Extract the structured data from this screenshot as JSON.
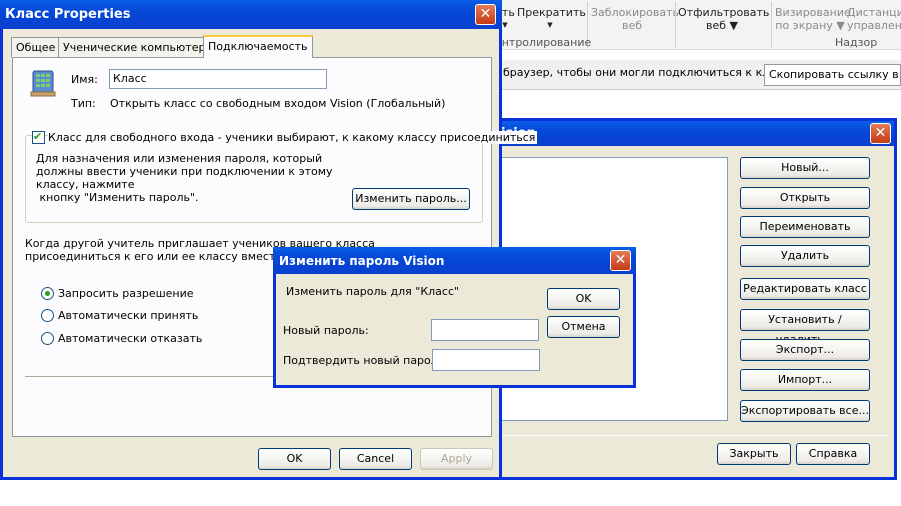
{
  "ribbon": {
    "items": [
      {
        "label": "ать",
        "arrow": "▼"
      },
      {
        "label": "Прекратить",
        "arrow": "▼"
      },
      {
        "label_line1": "Заблокировать",
        "label_line2": "веб"
      },
      {
        "label_line1": "Отфильтровать",
        "label_line2": "веб ▼"
      },
      {
        "label_line1": "Визирование",
        "label_line2": "по экрану ▼"
      },
      {
        "label_line1": "Дистанци",
        "label_line2": "управлен"
      }
    ],
    "group_control": "онтролирование",
    "group_supervision": "Надзор"
  },
  "address_bar": {
    "text": "браузер, чтобы они могли подключиться к классу.",
    "copy_link": "Скопировать ссылку в бу"
  },
  "vision_window": {
    "title": "ision",
    "buttons": [
      "Новый...",
      "Открыть",
      "Переименовать",
      "Удалить",
      "Редактировать класс",
      "Установить / удалить...",
      "Экспорт...",
      "Импорт...",
      "Экспортировать все..."
    ],
    "close": "Закрыть",
    "help": "Справка"
  },
  "props_window": {
    "title": "Класс Properties",
    "tabs": [
      "Общее",
      "Ученические компьютеры",
      "Подключаемость"
    ],
    "name_label": "Имя:",
    "name_value": "Класс",
    "type_label": "Тип:",
    "type_value": "Открыть класс со свободным входом Vision (Глобальный)",
    "checkbox_label": "Класс для свободного входа - ученики выбирают, к какому классу присоединиться",
    "checkbox_checked": true,
    "pwd_desc": [
      "Для назначения или изменения пароля, который",
      "должны ввести ученики при подключении к этому",
      "классу, нажмите",
      " кнопку \"Изменить пароль\"."
    ],
    "change_pwd_button": "Изменить пароль...",
    "invite_text": [
      "Когда другой учитель приглашает учеников вашего класса",
      "присоединиться к его или ее классу вместо Vision"
    ],
    "radios": [
      "Запросить разрешение",
      "Автоматически принять",
      "Автоматически отказать"
    ],
    "selected_radio": 0,
    "ok": "OK",
    "cancel": "Cancel",
    "apply": "Apply"
  },
  "pwd_dialog": {
    "title": "Изменить пароль Vision",
    "heading": "Изменить пароль для \"Класс\"",
    "new_label": "Новый пароль:",
    "confirm_label": "Подтвердить новый пароль:",
    "new_value": "",
    "confirm_value": "",
    "ok": "OK",
    "cancel": "Отмена"
  },
  "close_glyph": "✕",
  "check_glyph": "✔"
}
